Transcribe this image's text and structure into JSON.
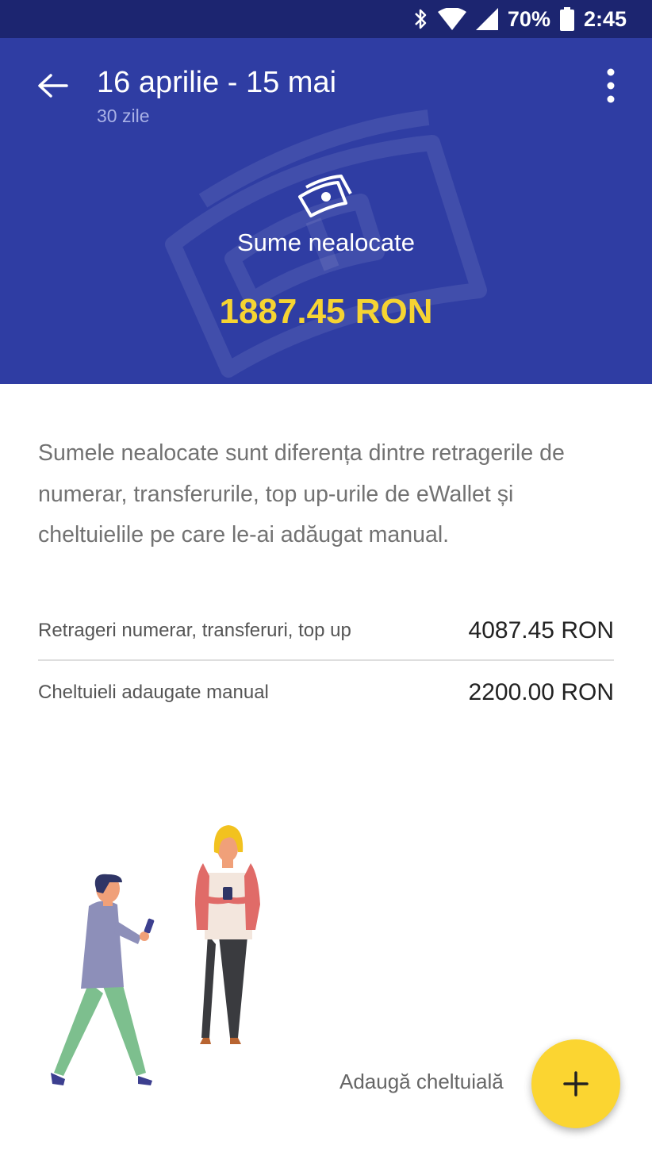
{
  "status_bar": {
    "battery_percent": "70%",
    "time": "2:45"
  },
  "header": {
    "title": "16 aprilie - 15 mai",
    "subtitle": "30 zile",
    "section_label": "Sume nealocate",
    "amount": "1887.45 RON"
  },
  "description": "Sumele nealocate sunt diferența dintre retragerile de numerar, transferurile, top up-urile de eWallet și cheltuielile pe care le-ai adăugat manual.",
  "breakdown": [
    {
      "label": "Retrageri numerar, transferuri, top up",
      "value": "4087.45 RON"
    },
    {
      "label": "Cheltuieli adaugate manual",
      "value": "2200.00 RON"
    }
  ],
  "fab": {
    "label": "Adaugă cheltuială"
  },
  "colors": {
    "status_bar": "#1c2570",
    "header_bg": "#2f3da3",
    "amount": "#f6d432",
    "fab": "#fbd531"
  },
  "icons": [
    "back-arrow-icon",
    "more-vert-icon",
    "money-bill-icon",
    "plus-icon",
    "bluetooth-icon",
    "wifi-icon",
    "signal-icon",
    "battery-icon"
  ]
}
